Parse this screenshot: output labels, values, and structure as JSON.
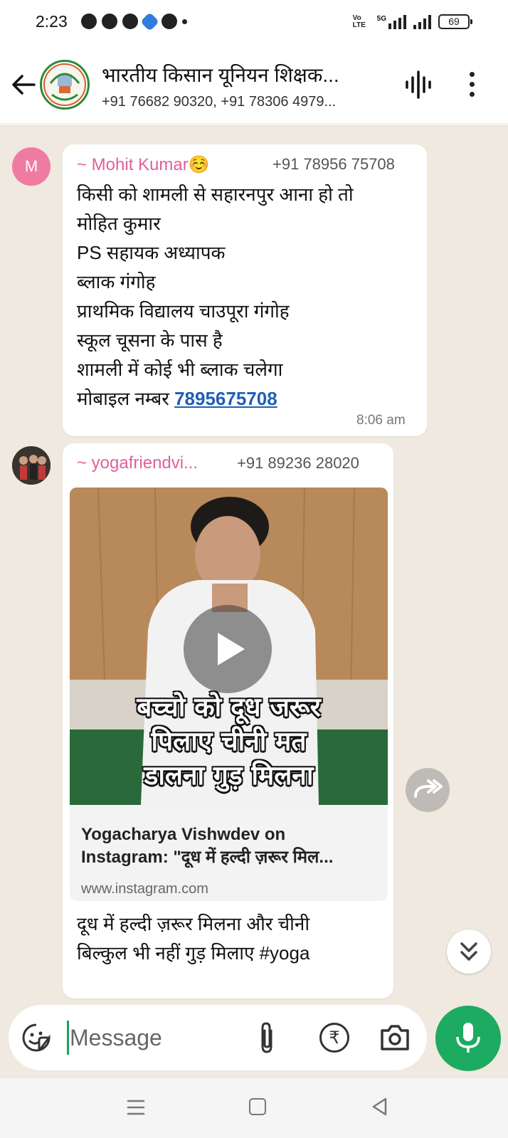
{
  "status_bar": {
    "time": "2:23",
    "network_label": "5G",
    "volte_label": "Vo LTE",
    "battery": "69"
  },
  "header": {
    "title": "भारतीय किसान यूनियन शिक्षक...",
    "subtitle": "+91 76682 90320, +91 78306 4979..."
  },
  "messages": [
    {
      "avatar_letter": "M",
      "sender": "~ Mohit Kumar☺️",
      "phone": "+91 78956 75708",
      "lines": [
        "किसी को शामली से सहारनपुर आना हो तो",
        "मोहित कुमार",
        "PS सहायक अध्यापक",
        "ब्लाक गंगोह",
        "प्राथमिक विद्यालय चाउपूरा गंगोह",
        "स्कूल चूसना के पास है",
        "शामली में कोई भी ब्लाक चलेगा"
      ],
      "last_line_prefix": "मोबाइल नम्बर ",
      "phone_link": "7895675708",
      "time": "8:06 am"
    },
    {
      "sender": "~ yogafriendvi...",
      "phone": "+91 89236 28020",
      "video_overlay": [
        "बच्चो को दूध जरूर",
        "पिलाए चीनी मत",
        "डालना गुड़ मिलना"
      ],
      "link_preview": {
        "title_line1": "Yogacharya Vishwdev on",
        "title_line2": "Instagram: \"दूध में हल्दी ज़रूर मिल...",
        "url": "www.instagram.com"
      },
      "caption_lines": [
        "दूध में हल्दी ज़रूर मिलना और चीनी",
        "बिल्कुल भी नहीं गुड़ मिलाए #yoga"
      ]
    }
  ],
  "composer": {
    "placeholder": "Message"
  },
  "colors": {
    "accent": "#1daa61",
    "sender": "#e0609a",
    "link": "#1f5fb5",
    "chat_bg": "#efe9df"
  }
}
